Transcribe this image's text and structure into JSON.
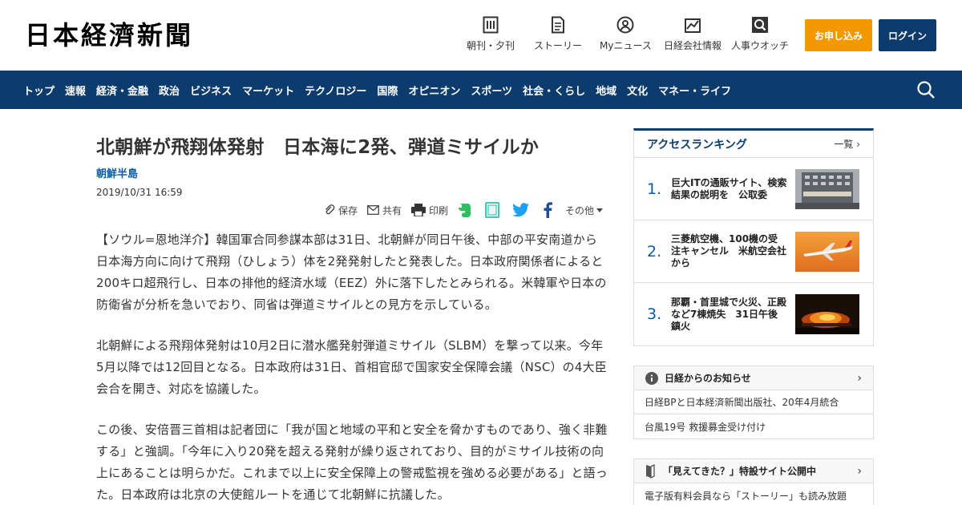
{
  "header": {
    "logo": "日本経濟新聞",
    "nav": [
      {
        "label": "朝刊・夕刊",
        "icon": "newspaper-icon"
      },
      {
        "label": "ストーリー",
        "icon": "story-icon"
      },
      {
        "label": "Myニュース",
        "icon": "my-news-icon"
      },
      {
        "label": "日経会社情報",
        "icon": "company-chart-icon"
      },
      {
        "label": "人事ウオッチ",
        "icon": "personnel-search-icon"
      }
    ],
    "subscribe_label": "お申し込み",
    "login_label": "ログイン"
  },
  "nav": {
    "items": [
      "トップ",
      "速報",
      "経済・金融",
      "政治",
      "ビジネス",
      "マーケット",
      "テクノロジー",
      "国際",
      "オピニオン",
      "スポーツ",
      "社会・くらし",
      "地域",
      "文化",
      "マネー・ライフ"
    ]
  },
  "article": {
    "title": "北朝鮮が飛翔体発射　日本海に2発、弾道ミサイルか",
    "category": "朝鮮半島",
    "date": "2019/10/31 16:59",
    "share": {
      "save": "保存",
      "share": "共有",
      "print": "印刷",
      "more": "その他"
    },
    "paragraphs": [
      "【ソウル=恩地洋介】韓国軍合同参謀本部は31日、北朝鮮が同日午後、中部の平安南道から日本海方向に向けて飛翔（ひしょう）体を2発発射したと発表した。日本政府関係者によると200キロ超飛行し、日本の排他的経済水域（EEZ）外に落下したとみられる。米韓軍や日本の防衛省が分析を急いでおり、同省は弾道ミサイルとの見方を示している。",
      "北朝鮮による飛翔体発射は10月2日に潜水艦発射弾道ミサイル（SLBM）を撃って以来。今年5月以降では12回目となる。日本政府は31日、首相官邸で国家安全保障会議（NSC）の4大臣会合を開き、対応を協議した。",
      "この後、安倍晋三首相は記者団に「我が国と地域の平和と安全を脅かすものであり、強く非難する」と強調。「今年に入り20発を超える発射が繰り返されており、目的がミサイル技術の向上にあることは明らかだ。これまで以上に安全保障上の警戒監視を強める必要がある」と語った。日本政府は北京の大使館ルートを通じて北朝鮮に抗議した。"
    ]
  },
  "ranking": {
    "title": "アクセスランキング",
    "more": "一覧",
    "items": [
      {
        "num": "1.",
        "text": "巨大ITの通販サイト、検索結果の説明を　公取委"
      },
      {
        "num": "2.",
        "text": "三菱航空機、100機の受注キャンセル　米航空会社から"
      },
      {
        "num": "3.",
        "text": "那覇・首里城で火災、正殿など7棟焼失　31日午後鎮火"
      }
    ]
  },
  "notice": {
    "title": "日経からのお知らせ",
    "items": [
      "日経BPと日本経済新聞出版社、20年4月統合",
      "台風19号 救援募金受け付け"
    ]
  },
  "story": {
    "title": "「見えてきた？」特設サイト公開中",
    "items": [
      "電子版有料会員なら「ストーリー」も読み放題"
    ]
  },
  "colors": {
    "navy": "#0c3c6e",
    "orange": "#f39800",
    "link_blue": "#0c5aa6"
  }
}
